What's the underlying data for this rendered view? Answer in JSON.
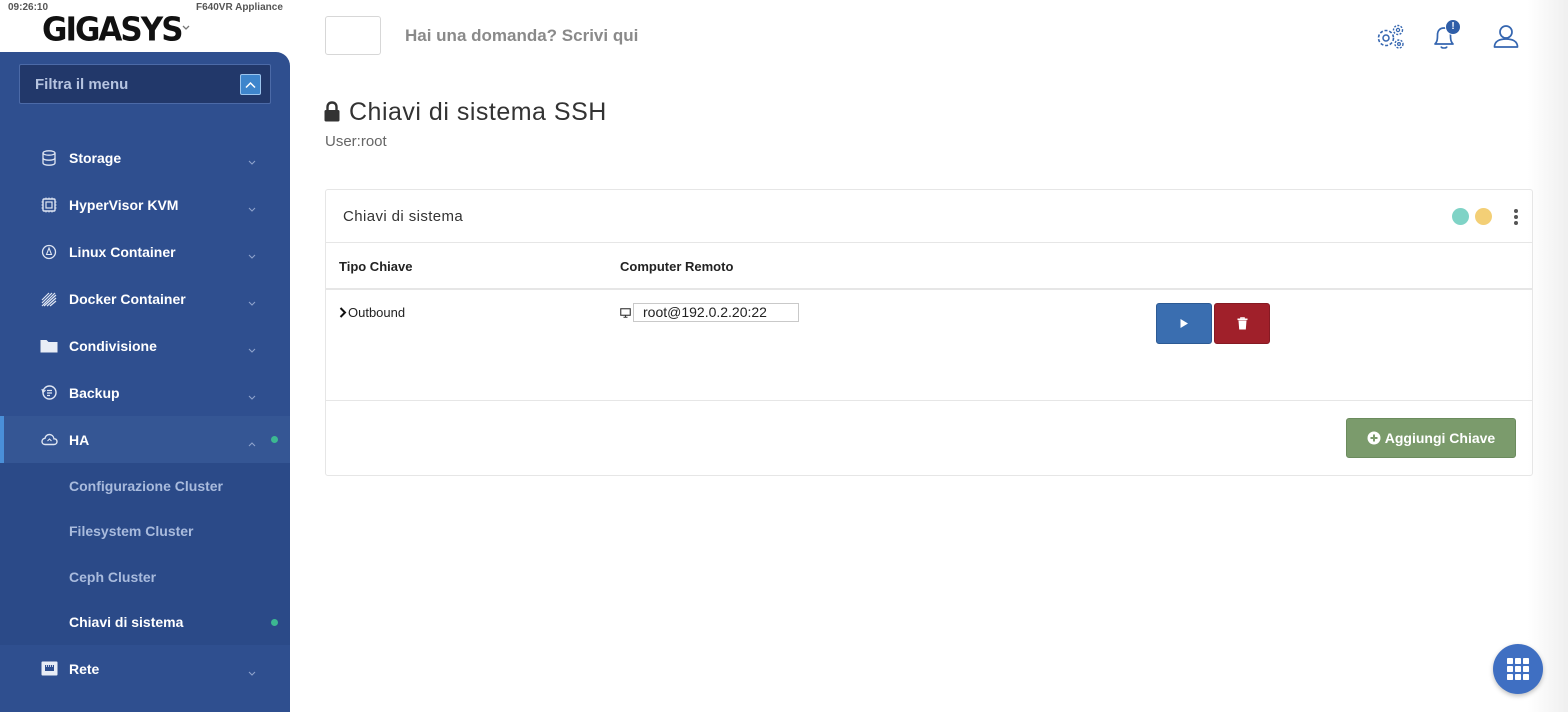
{
  "status_bar": {
    "clock": "09:26:10",
    "appliance": "F640VR Appliance"
  },
  "brand": {
    "logo_text": "GIGASYS"
  },
  "sidebar": {
    "filter_placeholder": "Filtra il menu",
    "items": [
      {
        "label": "Storage",
        "icon": "database-icon"
      },
      {
        "label": "HyperVisor KVM",
        "icon": "chip-icon"
      },
      {
        "label": "Linux Container",
        "icon": "container-icon"
      },
      {
        "label": "Docker Container",
        "icon": "docker-icon"
      },
      {
        "label": "Condivisione",
        "icon": "folder-icon"
      },
      {
        "label": "Backup",
        "icon": "backup-icon"
      },
      {
        "label": "HA",
        "icon": "cloud-icon"
      },
      {
        "label": "Rete",
        "icon": "network-icon"
      }
    ],
    "ha_subitems": [
      {
        "label": "Configurazione Cluster"
      },
      {
        "label": "Filesystem Cluster"
      },
      {
        "label": "Ceph Cluster"
      },
      {
        "label": "Chiavi di sistema"
      }
    ]
  },
  "header": {
    "question": "Hai una domanda? Scrivi qui",
    "notification_count": "!"
  },
  "page": {
    "title": "Chiavi di sistema SSH",
    "subtitle": "User:root"
  },
  "panel": {
    "title": "Chiavi di sistema",
    "columns": [
      "Tipo Chiave",
      "Computer Remoto"
    ],
    "rows": [
      {
        "type": "Outbound",
        "remote": "root@192.0.2.20:22"
      }
    ],
    "add_button": "Aggiungi Chiave"
  },
  "colors": {
    "sidebar": "#2f4f8f",
    "accent": "#3a6eb0",
    "danger": "#a0202a",
    "success": "#7b9b6c",
    "status_teal": "#7fd3c6",
    "status_yellow": "#f3cf76"
  }
}
